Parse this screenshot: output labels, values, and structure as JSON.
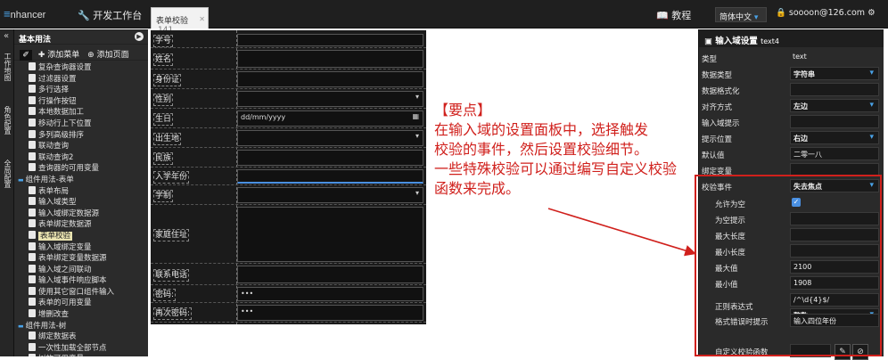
{
  "topbar": {
    "logo_prefix": "≡",
    "logo_text": "nhancer",
    "dev_workbench": "开发工作台",
    "tutorial": "教程",
    "language": "简体中文",
    "user_email": "soooon@126.com"
  },
  "tab": {
    "title": "表单校验",
    "count": "141"
  },
  "left_strip": {
    "vtabs": [
      "工作地图",
      "角色配置",
      "全局配置"
    ]
  },
  "sidebar": {
    "title": "基本用法",
    "add_menu": "添加菜单",
    "add_page": "添加页面",
    "items": [
      {
        "label": "复杂查询器设置",
        "kind": "doc"
      },
      {
        "label": "过滤器设置",
        "kind": "doc"
      },
      {
        "label": "多行选择",
        "kind": "doc"
      },
      {
        "label": "行操作按钮",
        "kind": "doc"
      },
      {
        "label": "本地数据加工",
        "kind": "doc"
      },
      {
        "label": "移动行上下位置",
        "kind": "doc"
      },
      {
        "label": "多列高级排序",
        "kind": "doc"
      },
      {
        "label": "联动查询",
        "kind": "doc"
      },
      {
        "label": "联动查询2",
        "kind": "doc"
      },
      {
        "label": "查询器的可用变量",
        "kind": "doc"
      },
      {
        "label": "组件用法-表单",
        "kind": "folder"
      },
      {
        "label": "表单布局",
        "kind": "doc"
      },
      {
        "label": "输入域类型",
        "kind": "doc"
      },
      {
        "label": "输入域绑定数据源",
        "kind": "doc"
      },
      {
        "label": "表单绑定数据源",
        "kind": "doc"
      },
      {
        "label": "表单校验",
        "kind": "doc",
        "selected": true
      },
      {
        "label": "输入域绑定变量",
        "kind": "doc"
      },
      {
        "label": "表单绑定变量数据源",
        "kind": "doc"
      },
      {
        "label": "输入域之间联动",
        "kind": "doc"
      },
      {
        "label": "输入域事件响应脚本",
        "kind": "doc"
      },
      {
        "label": "使用其它窗口组件输入",
        "kind": "doc"
      },
      {
        "label": "表单的可用变量",
        "kind": "doc"
      },
      {
        "label": "增删改查",
        "kind": "doc"
      },
      {
        "label": "组件用法-树",
        "kind": "folder"
      },
      {
        "label": "绑定数据表",
        "kind": "doc"
      },
      {
        "label": "一次性加载全部节点",
        "kind": "doc"
      },
      {
        "label": "树的可用变量",
        "kind": "doc"
      }
    ]
  },
  "form": {
    "fields": [
      {
        "label": "学号",
        "value": ""
      },
      {
        "label": "姓名",
        "value": ""
      },
      {
        "label": "身份证",
        "value": ""
      },
      {
        "label": "性别",
        "value": "",
        "type": "select"
      },
      {
        "label": "生日",
        "value": "dd/mm/yyyy",
        "type": "date"
      },
      {
        "label": "出生地",
        "value": "",
        "type": "select"
      },
      {
        "label": "民族",
        "value": ""
      },
      {
        "label": "入学年份",
        "value": ""
      },
      {
        "label": "学制",
        "value": "",
        "type": "select"
      },
      {
        "label": "家庭住址",
        "value": "",
        "type": "textarea"
      },
      {
        "label": "联系电话",
        "value": ""
      },
      {
        "label": "密码:",
        "value": "•••"
      },
      {
        "label": "再次密码:",
        "value": "•••"
      }
    ]
  },
  "annotation": {
    "line1": "【要点】",
    "line2": "在输入域的设置面板中，选择触发",
    "line3": "校验的事件，然后设置校验细节。",
    "line4": "一些特殊校验可以通过编写自定义校验",
    "line5": "函数来完成。",
    "color": "#d0201c"
  },
  "right_panel": {
    "title": "输入域设置",
    "subtitle": "text4",
    "props": [
      {
        "key": "类型",
        "value": "text",
        "plain": true
      },
      {
        "key": "数据类型",
        "value": "字符串",
        "dropdown": true
      },
      {
        "key": "数据格式化",
        "value": ""
      },
      {
        "key": "对齐方式",
        "value": "左边",
        "dropdown": true
      },
      {
        "key": "输入域提示",
        "value": ""
      },
      {
        "key": "提示位置",
        "value": "右边",
        "dropdown": true
      },
      {
        "key": "默认值",
        "value": "二零一八"
      },
      {
        "key": "绑定变量",
        "value": ""
      },
      {
        "key": "校验事件",
        "value": "失去焦点",
        "dropdown": true
      },
      {
        "key": "允许为空",
        "value": "",
        "check": true,
        "sub": true
      },
      {
        "key": "为空提示",
        "value": "",
        "sub": true
      },
      {
        "key": "最大长度",
        "value": "",
        "sub": true
      },
      {
        "key": "最小长度",
        "value": "",
        "sub": true
      },
      {
        "key": "最大值",
        "value": "2100",
        "sub": true
      },
      {
        "key": "最小值",
        "value": "1908",
        "sub": true
      },
      {
        "key": "正则表达式",
        "value": "/^\\d{4}$/",
        "value2": "整数",
        "sub": true
      },
      {
        "key": "格式错误时提示",
        "value": "输入四位年份",
        "sub": true
      },
      {
        "key": "自定义校验函数",
        "value": "",
        "sub": true
      }
    ]
  }
}
